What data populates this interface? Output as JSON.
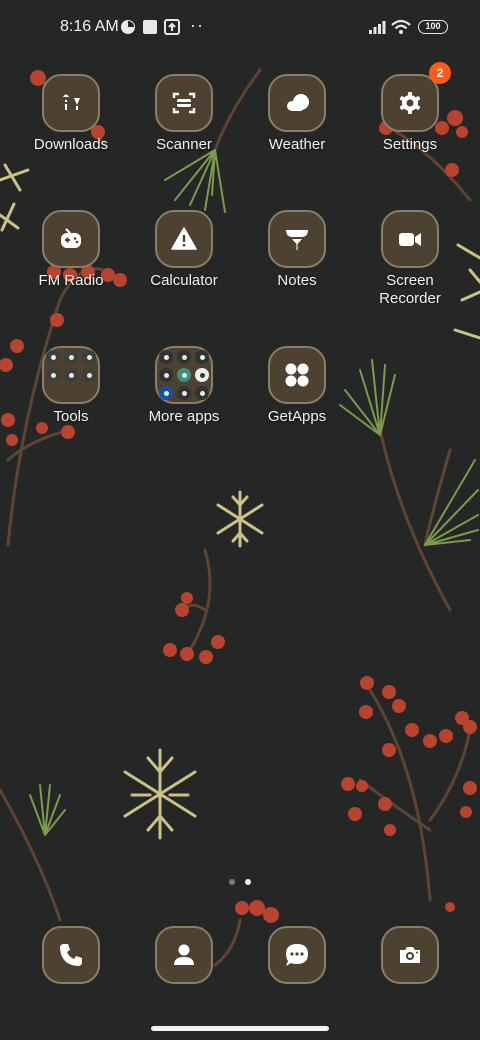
{
  "status_bar": {
    "time": "8:16 AM",
    "battery": "100"
  },
  "apps": {
    "downloads": "Downloads",
    "scanner": "Scanner",
    "weather": "Weather",
    "settings": "Settings",
    "settings_badge": "2",
    "fm_radio": "FM Radio",
    "calculator": "Calculator",
    "notes": "Notes",
    "screen_recorder": "Screen Recorder",
    "tools": "Tools",
    "more_apps": "More apps",
    "getapps": "GetApps"
  },
  "dock": [
    "phone-icon",
    "contacts-icon",
    "messages-icon",
    "camera-icon"
  ],
  "colors": {
    "background": "#242726",
    "icon_fill": "#4d4232",
    "icon_border": "#8a7e66",
    "badge": "#ff5a1a",
    "berry": "#b8432f",
    "branch": "#5e4434",
    "pine": "#7d9a4c",
    "snowflake": "#ccc186"
  }
}
